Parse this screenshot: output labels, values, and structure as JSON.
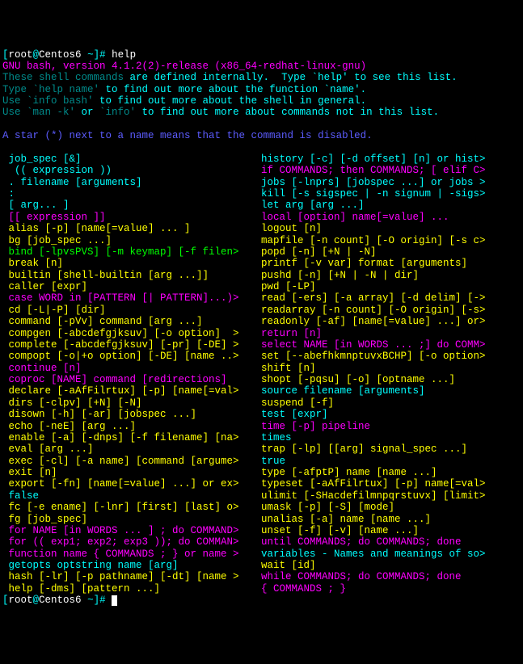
{
  "prompt": {
    "user": "root",
    "at": "@",
    "host": "Centos6",
    "path": " ~",
    "sep": "]# ",
    "cmd": "help"
  },
  "header": {
    "l1": "GNU bash, version 4.1.2(2)-release (x86_64-redhat-linux-gnu)",
    "l2a": "These shell commands",
    "l2b": " are defined internally.  Type `help' to see this list.",
    "l3a": "Type `help name'",
    "l3b": " to find out more about the function `name'.",
    "l4a": "Use `info bash'",
    "l4b": " to find out more about the shell in general.",
    "l5a": "Use `man -k'",
    "l5b": " or ",
    "l5c": "`info'",
    "l5d": " to find out more about commands not in this list.",
    "star": "A star (*) next to a name means that the command is disabled."
  },
  "cols": [
    {
      "l": "job_spec [&]",
      "r": "history [-c] [-d offset] [n] or hist>",
      "cl": "cyan",
      "cr": "cyan"
    },
    {
      "l": " (( expression ))",
      "r": "if COMMANDS; then COMMANDS; [ elif C>",
      "cl": "cyan",
      "cr": "magenta"
    },
    {
      "l": ". filename [arguments]",
      "r": "jobs [-lnprs] [jobspec ...] or jobs >",
      "cl": "cyan",
      "cr": "cyan"
    },
    {
      "l": ":",
      "r": "kill [-s sigspec | -n signum | -sigs>",
      "cl": "cyan",
      "cr": "cyan"
    },
    {
      "l": "[ arg... ]",
      "r": "let arg [arg ...]",
      "cl": "cyan",
      "cr": "cyan"
    },
    {
      "l": "[[ expression ]]",
      "r": "local [option] name[=value] ...",
      "cl": "magenta",
      "cr": "magenta"
    },
    {
      "l": "alias [-p] [name[=value] ... ]",
      "r": "logout [n]",
      "cl": "yellow",
      "cr": "yellow"
    },
    {
      "l": "bg [job_spec ...]",
      "r": "mapfile [-n count] [-O origin] [-s c>",
      "cl": "yellow",
      "cr": "yellow"
    },
    {
      "l": "bind [-lpvsPVS] [-m keymap] [-f filen>",
      "r": "popd [-n] [+N | -N]",
      "cl": "green",
      "cr": "yellow"
    },
    {
      "l": "break [n]",
      "r": "printf [-v var] format [arguments]",
      "cl": "yellow",
      "cr": "yellow"
    },
    {
      "l": "builtin [shell-builtin [arg ...]]",
      "r": "pushd [-n] [+N | -N | dir]",
      "cl": "yellow",
      "cr": "yellow"
    },
    {
      "l": "caller [expr]",
      "r": "pwd [-LP]",
      "cl": "yellow",
      "cr": "yellow"
    },
    {
      "l": "case WORD in [PATTERN [| PATTERN]...)>",
      "r": "read [-ers] [-a array] [-d delim] [->",
      "cl": "magenta",
      "cr": "yellow"
    },
    {
      "l": "cd [-L|-P] [dir]",
      "r": "readarray [-n count] [-O origin] [-s>",
      "cl": "yellow",
      "cr": "yellow"
    },
    {
      "l": "command [-pVv] command [arg ...]",
      "r": "readonly [-af] [name[=value] ...] or>",
      "cl": "yellow",
      "cr": "yellow"
    },
    {
      "l": "compgen [-abcdefgjksuv] [-o option]  >",
      "r": "return [n]",
      "cl": "yellow",
      "cr": "magenta"
    },
    {
      "l": "complete [-abcdefgjksuv] [-pr] [-DE] >",
      "r": "select NAME [in WORDS ... ;] do COMM>",
      "cl": "yellow",
      "cr": "magenta"
    },
    {
      "l": "compopt [-o|+o option] [-DE] [name ..>",
      "r": "set [--abefhkmnptuvxBCHP] [-o option>",
      "cl": "yellow",
      "cr": "yellow"
    },
    {
      "l": "continue [n]",
      "r": "shift [n]",
      "cl": "magenta",
      "cr": "yellow"
    },
    {
      "l": "coproc [NAME] command [redirections]",
      "r": "shopt [-pqsu] [-o] [optname ...]",
      "cl": "magenta",
      "cr": "yellow"
    },
    {
      "l": "declare [-aAfFilrtux] [-p] [name[=val>",
      "r": "source filename [arguments]",
      "cl": "yellow",
      "cr": "cyan"
    },
    {
      "l": "dirs [-clpv] [+N] [-N]",
      "r": "suspend [-f]",
      "cl": "yellow",
      "cr": "yellow"
    },
    {
      "l": "disown [-h] [-ar] [jobspec ...]",
      "r": "test [expr]",
      "cl": "yellow",
      "cr": "cyan"
    },
    {
      "l": "echo [-neE] [arg ...]",
      "r": "time [-p] pipeline",
      "cl": "yellow",
      "cr": "magenta"
    },
    {
      "l": "enable [-a] [-dnps] [-f filename] [na>",
      "r": "times",
      "cl": "yellow",
      "cr": "cyan"
    },
    {
      "l": "eval [arg ...]",
      "r": "trap [-lp] [[arg] signal_spec ...]",
      "cl": "yellow",
      "cr": "yellow"
    },
    {
      "l": "exec [-cl] [-a name] [command [argume>",
      "r": "true",
      "cl": "yellow",
      "cr": "cyan"
    },
    {
      "l": "exit [n]",
      "r": "type [-afptP] name [name ...]",
      "cl": "yellow",
      "cr": "yellow"
    },
    {
      "l": "export [-fn] [name[=value] ...] or ex>",
      "r": "typeset [-aAfFilrtux] [-p] name[=val>",
      "cl": "yellow",
      "cr": "yellow"
    },
    {
      "l": "false",
      "r": "ulimit [-SHacdefilmnpqrstuvx] [limit>",
      "cl": "cyan",
      "cr": "yellow"
    },
    {
      "l": "fc [-e ename] [-lnr] [first] [last] o>",
      "r": "umask [-p] [-S] [mode]",
      "cl": "yellow",
      "cr": "yellow"
    },
    {
      "l": "fg [job_spec]",
      "r": "unalias [-a] name [name ...]",
      "cl": "yellow",
      "cr": "yellow"
    },
    {
      "l": "for NAME [in WORDS ... ] ; do COMMAND>",
      "r": "unset [-f] [-v] [name ...]",
      "cl": "magenta",
      "cr": "yellow"
    },
    {
      "l": "for (( exp1; exp2; exp3 )); do COMMAN>",
      "r": "until COMMANDS; do COMMANDS; done",
      "cl": "magenta",
      "cr": "magenta"
    },
    {
      "l": "function name { COMMANDS ; } or name >",
      "r": "variables - Names and meanings of so>",
      "cl": "magenta",
      "cr": "cyan"
    },
    {
      "l": "getopts optstring name [arg]",
      "r": "wait [id]",
      "cl": "cyan",
      "cr": "yellow"
    },
    {
      "l": "hash [-lr] [-p pathname] [-dt] [name >",
      "r": "while COMMANDS; do COMMANDS; done",
      "cl": "yellow",
      "cr": "magenta"
    },
    {
      "l": "help [-dms] [pattern ...]",
      "r": "{ COMMANDS ; }",
      "cl": "yellow",
      "cr": "magenta"
    }
  ]
}
